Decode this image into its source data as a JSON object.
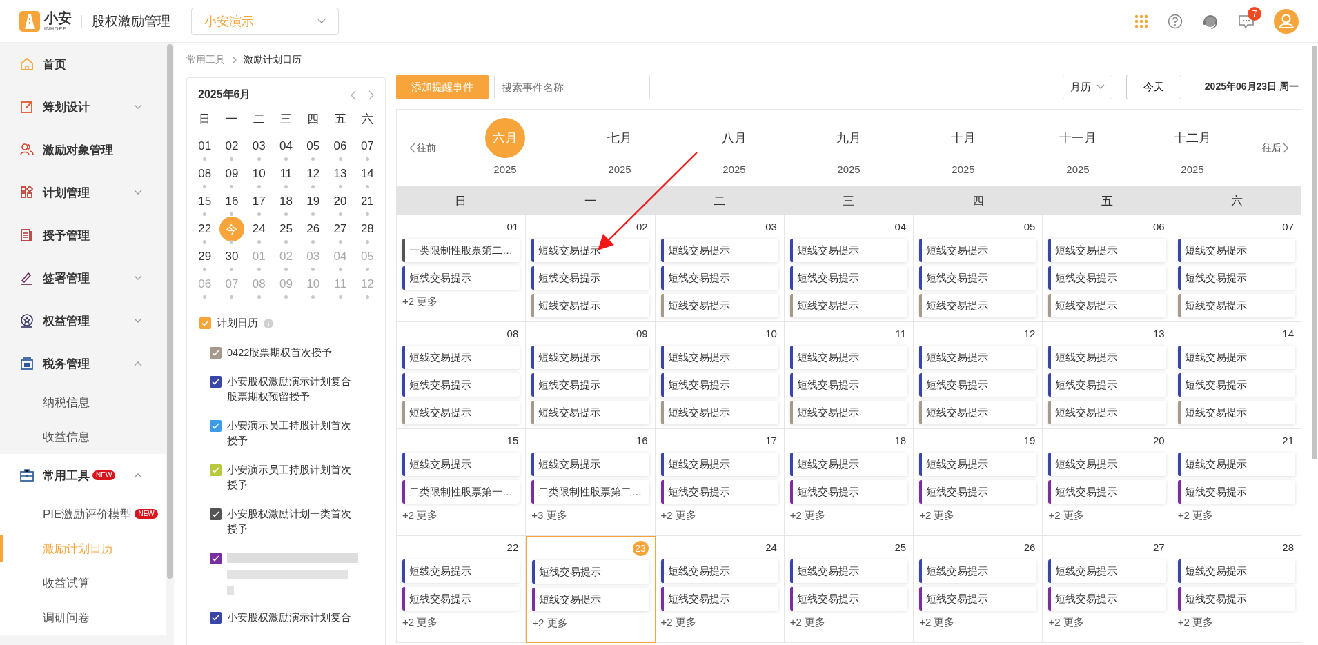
{
  "header": {
    "logo_text": "小安",
    "logo_subtext": "INHOPE",
    "app_title": "股权激励管理",
    "org_select": {
      "value": "小安演示"
    },
    "message_badge": "7"
  },
  "sidebar": {
    "items": [
      {
        "label": "首页",
        "selected": false
      },
      {
        "label": "筹划设计",
        "selected": false,
        "expanded": false
      },
      {
        "label": "激励对象管理",
        "selected": false
      },
      {
        "label": "计划管理",
        "selected": false,
        "expanded": false
      },
      {
        "label": "授予管理",
        "selected": false
      },
      {
        "label": "签署管理",
        "selected": false,
        "expanded": false
      },
      {
        "label": "权益管理",
        "selected": false,
        "expanded": false
      },
      {
        "label": "税务管理",
        "selected": false,
        "expanded": true,
        "children": [
          {
            "label": "纳税信息",
            "selected": false
          },
          {
            "label": "收益信息",
            "selected": false
          }
        ]
      },
      {
        "label": "常用工具",
        "badge": "NEW",
        "selected": false,
        "expanded": true,
        "children": [
          {
            "label": "PIE激励评价模型",
            "badge": "NEW",
            "selected": false
          },
          {
            "label": "激励计划日历",
            "selected": true
          },
          {
            "label": "收益试算",
            "selected": false
          },
          {
            "label": "调研问卷",
            "selected": false
          }
        ]
      }
    ]
  },
  "breadcrumb": [
    "常用工具",
    "激励计划日历"
  ],
  "mini_calendar": {
    "title": "2025年6月",
    "weekdays": [
      "日",
      "一",
      "二",
      "三",
      "四",
      "五",
      "六"
    ],
    "weeks": [
      [
        {
          "label": "01",
          "in_month": true,
          "selected": false
        },
        {
          "label": "02",
          "in_month": true,
          "selected": false
        },
        {
          "label": "03",
          "in_month": true,
          "selected": false
        },
        {
          "label": "04",
          "in_month": true,
          "selected": false
        },
        {
          "label": "05",
          "in_month": true,
          "selected": false
        },
        {
          "label": "06",
          "in_month": true,
          "selected": false
        },
        {
          "label": "07",
          "in_month": true,
          "selected": false
        }
      ],
      [
        {
          "label": "08",
          "in_month": true,
          "selected": false
        },
        {
          "label": "09",
          "in_month": true,
          "selected": false
        },
        {
          "label": "10",
          "in_month": true,
          "selected": false
        },
        {
          "label": "11",
          "in_month": true,
          "selected": false
        },
        {
          "label": "12",
          "in_month": true,
          "selected": false
        },
        {
          "label": "13",
          "in_month": true,
          "selected": false
        },
        {
          "label": "14",
          "in_month": true,
          "selected": false
        }
      ],
      [
        {
          "label": "15",
          "in_month": true,
          "selected": false
        },
        {
          "label": "16",
          "in_month": true,
          "selected": false
        },
        {
          "label": "17",
          "in_month": true,
          "selected": false
        },
        {
          "label": "18",
          "in_month": true,
          "selected": false
        },
        {
          "label": "19",
          "in_month": true,
          "selected": false
        },
        {
          "label": "20",
          "in_month": true,
          "selected": false
        },
        {
          "label": "21",
          "in_month": true,
          "selected": false
        }
      ],
      [
        {
          "label": "22",
          "in_month": true,
          "selected": false
        },
        {
          "label": "今",
          "in_month": true,
          "selected": true
        },
        {
          "label": "24",
          "in_month": true,
          "selected": false
        },
        {
          "label": "25",
          "in_month": true,
          "selected": false
        },
        {
          "label": "26",
          "in_month": true,
          "selected": false
        },
        {
          "label": "27",
          "in_month": true,
          "selected": false
        },
        {
          "label": "28",
          "in_month": true,
          "selected": false
        }
      ],
      [
        {
          "label": "29",
          "in_month": true,
          "selected": false
        },
        {
          "label": "30",
          "in_month": true,
          "selected": false
        },
        {
          "label": "01",
          "in_month": false,
          "selected": false
        },
        {
          "label": "02",
          "in_month": false,
          "selected": false
        },
        {
          "label": "03",
          "in_month": false,
          "selected": false
        },
        {
          "label": "04",
          "in_month": false,
          "selected": false
        },
        {
          "label": "05",
          "in_month": false,
          "selected": false
        }
      ],
      [
        {
          "label": "06",
          "in_month": false,
          "selected": false
        },
        {
          "label": "07",
          "in_month": false,
          "selected": false
        },
        {
          "label": "08",
          "in_month": false,
          "selected": false
        },
        {
          "label": "09",
          "in_month": false,
          "selected": false
        },
        {
          "label": "10",
          "in_month": false,
          "selected": false
        },
        {
          "label": "11",
          "in_month": false,
          "selected": false
        },
        {
          "label": "12",
          "in_month": false,
          "selected": false
        }
      ]
    ]
  },
  "calendar_filters": {
    "all": {
      "label": "计划日历",
      "checked": true
    },
    "items": [
      {
        "kind": "plan",
        "label": "0422股票期权首次授予",
        "color": "#a69a8c",
        "checked": true
      },
      {
        "kind": "plan",
        "label": "小安股权激励演示计划复合股票期权预留授予",
        "color": "#3a45a8",
        "checked": true
      },
      {
        "kind": "plan",
        "label": "小安演示员工持股计划首次授予",
        "color": "#3e9be8",
        "checked": true
      },
      {
        "kind": "plan",
        "label": "小安演示员工持股计划首次授予",
        "color": "#b8c93e",
        "checked": true
      },
      {
        "kind": "plan",
        "label": "小安股权激励计划一类首次授予",
        "color": "#555555",
        "checked": true
      },
      {
        "kind": "redacted",
        "color": "#7a2ea0",
        "checked": true
      },
      {
        "kind": "plan",
        "label": "小安股权激励演示计划复合",
        "color": "#3a45a8",
        "checked": true
      }
    ]
  },
  "toolbar": {
    "add_button": "添加提醒事件",
    "search": {
      "placeholder": "搜索事件名称"
    },
    "view_select": "月历",
    "today_button": "今天",
    "current_date": "2025年06月23日 周一"
  },
  "month_strip": {
    "prev": "往前",
    "next": "往后",
    "months": [
      {
        "name": "六月",
        "year": "2025",
        "selected": true
      },
      {
        "name": "七月",
        "year": "2025",
        "selected": false
      },
      {
        "name": "八月",
        "year": "2025",
        "selected": false
      },
      {
        "name": "九月",
        "year": "2025",
        "selected": false
      },
      {
        "name": "十月",
        "year": "2025",
        "selected": false
      },
      {
        "name": "十一月",
        "year": "2025",
        "selected": false
      },
      {
        "name": "十二月",
        "year": "2025",
        "selected": false
      }
    ]
  },
  "calendar": {
    "weekdays": [
      "日",
      "一",
      "二",
      "三",
      "四",
      "五",
      "六"
    ],
    "weeks": [
      [
        {
          "date": "01",
          "selected": false,
          "events": [
            {
              "title": "一类限制性股票第二…",
              "color": "#555555"
            },
            {
              "title": "短线交易提示",
              "color": "#3a45a8"
            }
          ],
          "more": "+2 更多"
        },
        {
          "date": "02",
          "selected": false,
          "events": [
            {
              "title": "短线交易提示",
              "color": "#3a45a8"
            },
            {
              "title": "短线交易提示",
              "color": "#3a45a8"
            },
            {
              "title": "短线交易提示",
              "color": "#a69a8c"
            }
          ]
        },
        {
          "date": "03",
          "selected": false,
          "events": [
            {
              "title": "短线交易提示",
              "color": "#3a45a8"
            },
            {
              "title": "短线交易提示",
              "color": "#3a45a8"
            },
            {
              "title": "短线交易提示",
              "color": "#a69a8c"
            }
          ]
        },
        {
          "date": "04",
          "selected": false,
          "events": [
            {
              "title": "短线交易提示",
              "color": "#3a45a8"
            },
            {
              "title": "短线交易提示",
              "color": "#3a45a8"
            },
            {
              "title": "短线交易提示",
              "color": "#a69a8c"
            }
          ]
        },
        {
          "date": "05",
          "selected": false,
          "events": [
            {
              "title": "短线交易提示",
              "color": "#3a45a8"
            },
            {
              "title": "短线交易提示",
              "color": "#3a45a8"
            },
            {
              "title": "短线交易提示",
              "color": "#a69a8c"
            }
          ]
        },
        {
          "date": "06",
          "selected": false,
          "events": [
            {
              "title": "短线交易提示",
              "color": "#3a45a8"
            },
            {
              "title": "短线交易提示",
              "color": "#3a45a8"
            },
            {
              "title": "短线交易提示",
              "color": "#a69a8c"
            }
          ]
        },
        {
          "date": "07",
          "selected": false,
          "events": [
            {
              "title": "短线交易提示",
              "color": "#3a45a8"
            },
            {
              "title": "短线交易提示",
              "color": "#3a45a8"
            },
            {
              "title": "短线交易提示",
              "color": "#a69a8c"
            }
          ]
        }
      ],
      [
        {
          "date": "08",
          "selected": false,
          "events": [
            {
              "title": "短线交易提示",
              "color": "#3a45a8"
            },
            {
              "title": "短线交易提示",
              "color": "#3a45a8"
            },
            {
              "title": "短线交易提示",
              "color": "#a69a8c"
            }
          ]
        },
        {
          "date": "09",
          "selected": false,
          "events": [
            {
              "title": "短线交易提示",
              "color": "#3a45a8"
            },
            {
              "title": "短线交易提示",
              "color": "#3a45a8"
            },
            {
              "title": "短线交易提示",
              "color": "#a69a8c"
            }
          ]
        },
        {
          "date": "10",
          "selected": false,
          "events": [
            {
              "title": "短线交易提示",
              "color": "#3a45a8"
            },
            {
              "title": "短线交易提示",
              "color": "#3a45a8"
            },
            {
              "title": "短线交易提示",
              "color": "#a69a8c"
            }
          ]
        },
        {
          "date": "11",
          "selected": false,
          "events": [
            {
              "title": "短线交易提示",
              "color": "#3a45a8"
            },
            {
              "title": "短线交易提示",
              "color": "#3a45a8"
            },
            {
              "title": "短线交易提示",
              "color": "#a69a8c"
            }
          ]
        },
        {
          "date": "12",
          "selected": false,
          "events": [
            {
              "title": "短线交易提示",
              "color": "#3a45a8"
            },
            {
              "title": "短线交易提示",
              "color": "#3a45a8"
            },
            {
              "title": "短线交易提示",
              "color": "#a69a8c"
            }
          ]
        },
        {
          "date": "13",
          "selected": false,
          "events": [
            {
              "title": "短线交易提示",
              "color": "#3a45a8"
            },
            {
              "title": "短线交易提示",
              "color": "#3a45a8"
            },
            {
              "title": "短线交易提示",
              "color": "#a69a8c"
            }
          ]
        },
        {
          "date": "14",
          "selected": false,
          "events": [
            {
              "title": "短线交易提示",
              "color": "#3a45a8"
            },
            {
              "title": "短线交易提示",
              "color": "#3a45a8"
            },
            {
              "title": "短线交易提示",
              "color": "#a69a8c"
            }
          ]
        }
      ],
      [
        {
          "date": "15",
          "selected": false,
          "events": [
            {
              "title": "短线交易提示",
              "color": "#3a45a8"
            },
            {
              "title": "二类限制性股票第一…",
              "color": "#7a2ea0"
            }
          ],
          "more": "+2 更多"
        },
        {
          "date": "16",
          "selected": false,
          "events": [
            {
              "title": "短线交易提示",
              "color": "#3a45a8"
            },
            {
              "title": "二类限制性股票第二…",
              "color": "#7a2ea0"
            }
          ],
          "more": "+3 更多"
        },
        {
          "date": "17",
          "selected": false,
          "events": [
            {
              "title": "短线交易提示",
              "color": "#3a45a8"
            },
            {
              "title": "短线交易提示",
              "color": "#7a2ea0"
            }
          ],
          "more": "+2 更多"
        },
        {
          "date": "18",
          "selected": false,
          "events": [
            {
              "title": "短线交易提示",
              "color": "#3a45a8"
            },
            {
              "title": "短线交易提示",
              "color": "#7a2ea0"
            }
          ],
          "more": "+2 更多"
        },
        {
          "date": "19",
          "selected": false,
          "events": [
            {
              "title": "短线交易提示",
              "color": "#3a45a8"
            },
            {
              "title": "短线交易提示",
              "color": "#7a2ea0"
            }
          ],
          "more": "+2 更多"
        },
        {
          "date": "20",
          "selected": false,
          "events": [
            {
              "title": "短线交易提示",
              "color": "#3a45a8"
            },
            {
              "title": "短线交易提示",
              "color": "#7a2ea0"
            }
          ],
          "more": "+2 更多"
        },
        {
          "date": "21",
          "selected": false,
          "events": [
            {
              "title": "短线交易提示",
              "color": "#3a45a8"
            },
            {
              "title": "短线交易提示",
              "color": "#7a2ea0"
            }
          ],
          "more": "+2 更多"
        }
      ],
      [
        {
          "date": "22",
          "selected": false,
          "events": [
            {
              "title": "短线交易提示",
              "color": "#3a45a8"
            },
            {
              "title": "短线交易提示",
              "color": "#7a2ea0"
            }
          ],
          "more": "+2 更多"
        },
        {
          "date": "23",
          "selected": true,
          "events": [
            {
              "title": "短线交易提示",
              "color": "#3a45a8"
            },
            {
              "title": "短线交易提示",
              "color": "#7a2ea0"
            }
          ],
          "more": "+2 更多"
        },
        {
          "date": "24",
          "selected": false,
          "events": [
            {
              "title": "短线交易提示",
              "color": "#3a45a8"
            },
            {
              "title": "短线交易提示",
              "color": "#7a2ea0"
            }
          ],
          "more": "+2 更多"
        },
        {
          "date": "25",
          "selected": false,
          "events": [
            {
              "title": "短线交易提示",
              "color": "#3a45a8"
            },
            {
              "title": "短线交易提示",
              "color": "#7a2ea0"
            }
          ],
          "more": "+2 更多"
        },
        {
          "date": "26",
          "selected": false,
          "events": [
            {
              "title": "短线交易提示",
              "color": "#3a45a8"
            },
            {
              "title": "短线交易提示",
              "color": "#7a2ea0"
            }
          ],
          "more": "+2 更多"
        },
        {
          "date": "27",
          "selected": false,
          "events": [
            {
              "title": "短线交易提示",
              "color": "#3a45a8"
            },
            {
              "title": "短线交易提示",
              "color": "#7a2ea0"
            }
          ],
          "more": "+2 更多"
        },
        {
          "date": "28",
          "selected": false,
          "events": [
            {
              "title": "短线交易提示",
              "color": "#3a45a8"
            },
            {
              "title": "短线交易提示",
              "color": "#7a2ea0"
            }
          ],
          "more": "+2 更多"
        }
      ]
    ]
  }
}
